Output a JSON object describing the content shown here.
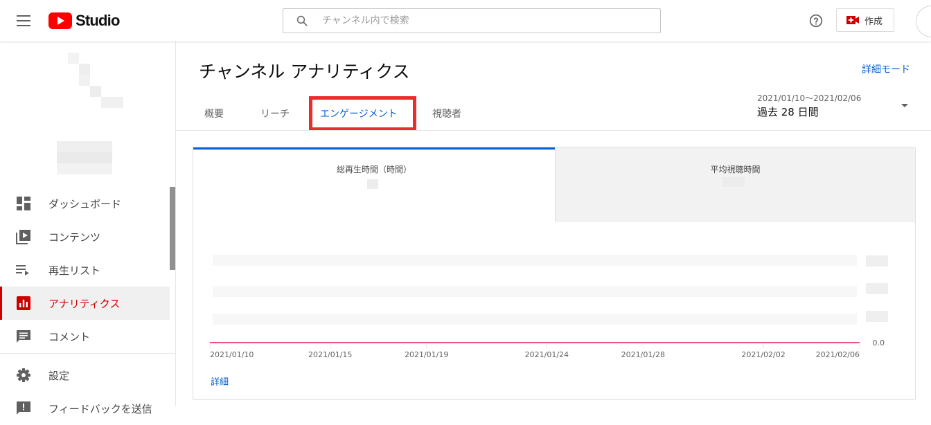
{
  "header": {
    "logo_text": "Studio",
    "search_placeholder": "チャンネル内で検索",
    "create_label": "作成"
  },
  "sidebar": {
    "items": [
      {
        "label": "ダッシュボード",
        "icon": "dashboard-icon"
      },
      {
        "label": "コンテンツ",
        "icon": "content-icon"
      },
      {
        "label": "再生リスト",
        "icon": "playlist-icon"
      },
      {
        "label": "アナリティクス",
        "icon": "analytics-icon",
        "active": true
      },
      {
        "label": "コメント",
        "icon": "comment-icon"
      },
      {
        "label": "設定",
        "icon": "gear-icon"
      },
      {
        "label": "フィードバックを送信",
        "icon": "feedback-icon"
      }
    ]
  },
  "main": {
    "title": "チャンネル アナリティクス",
    "advanced_link": "詳細モード",
    "tabs": [
      {
        "label": "概要"
      },
      {
        "label": "リーチ"
      },
      {
        "label": "エンゲージメント",
        "active": true
      },
      {
        "label": "視聴者"
      }
    ],
    "date": {
      "range": "2021/01/10〜2021/02/06",
      "preset": "過去 28 日間"
    }
  },
  "card": {
    "metrics": [
      {
        "label": "総再生時間（時間）",
        "selected": true
      },
      {
        "label": "平均視聴時間",
        "selected": false
      }
    ],
    "details_link": "詳細"
  },
  "colors": {
    "accent": "#065fd4",
    "brand_red": "#ff0000",
    "active_red": "#cc0000",
    "line": "#e91e63",
    "highlight_box": "#ee2b2b"
  },
  "chart_data": {
    "type": "line",
    "x": [
      "2021/01/10",
      "2021/01/11",
      "2021/01/12",
      "2021/01/13",
      "2021/01/14",
      "2021/01/15",
      "2021/01/16",
      "2021/01/17",
      "2021/01/18",
      "2021/01/19",
      "2021/01/20",
      "2021/01/21",
      "2021/01/22",
      "2021/01/23",
      "2021/01/24",
      "2021/01/25",
      "2021/01/26",
      "2021/01/27",
      "2021/01/28",
      "2021/01/29",
      "2021/01/30",
      "2021/01/31",
      "2021/02/01",
      "2021/02/02",
      "2021/02/03",
      "2021/02/04",
      "2021/02/05",
      "2021/02/06"
    ],
    "series": [
      {
        "values": [
          0,
          0,
          0,
          0,
          0,
          0,
          0,
          0,
          0,
          0,
          0,
          0,
          0,
          0,
          0,
          0,
          0,
          0,
          0,
          0,
          0,
          0,
          0,
          0,
          0,
          0,
          0,
          0
        ]
      }
    ],
    "x_tick_labels": [
      "2021/01/10",
      "2021/01/15",
      "2021/01/19",
      "2021/01/24",
      "2021/01/28",
      "2021/02/02",
      "2021/02/06"
    ],
    "y_tick_labels": [
      "0.0"
    ],
    "ylim": [
      0,
      1
    ],
    "grid": true,
    "title": "",
    "xlabel": "",
    "ylabel": ""
  }
}
